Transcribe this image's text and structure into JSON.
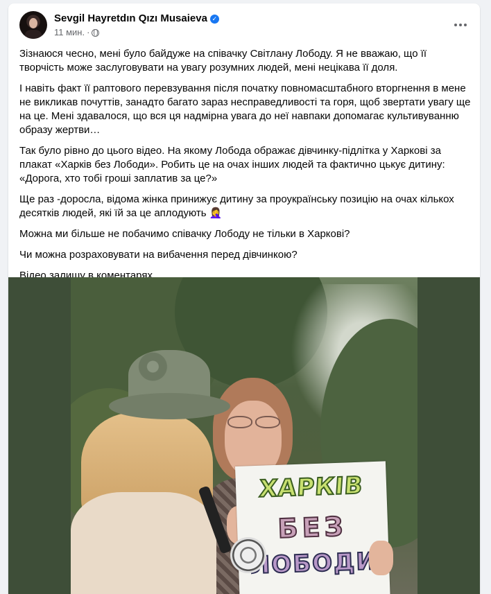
{
  "post": {
    "author": "Sevgil Hayretdın Qızı Musaieva",
    "time": "11 мин.",
    "separator": "·",
    "paragraphs": [
      "Зізнаюся чесно, мені було байдуже на співачку Світлану Лободу.  Я не вважаю, що її творчість може заслуговувати на увагу розумних людей, мені нецікава її доля.",
      "І навіть факт її раптового перевзування після початку повномасштабного вторгнення в мене не викликав почуттів, занадто багато зараз несправедливості та горя, щоб звертати увагу ще на це. Мені здавалося, що вся ця надмірна увага до неї навпаки допомагає культивуванню образу жертви…",
      "Так було рівно до цього відео. На якому Лобода ображає дівчинку-підлітка у Харкові за плакат «Харків без Лободи». Робить це на очах інших людей та фактично цькує дитину: «Дорога, хто тобі гроші заплатив за це?»",
      "Ще раз -доросла, відома жінка принижує дитину за проукраїнську позицію на очах кількох десятків людей, які їй за це аплодують 🤦‍♀️",
      "Можна ми більше не побачимо співачку Лободу не тільки в Харкові?",
      "Чи можна розраховувати на вибачення перед дівчинкою?",
      "Відео залишу в коментарях"
    ]
  },
  "video": {
    "poster_lines": [
      "ХАРКІВ",
      "БЕЗ",
      "ЛОБОДИ"
    ]
  },
  "icons": {
    "verified": "verified-badge-icon",
    "privacy": "globe-icon",
    "more": "more-options-icon"
  },
  "colors": {
    "page_bg": "#f0f2f5",
    "card_bg": "#ffffff",
    "accent": "#1877f2",
    "secondary_text": "#65676b",
    "media_bg": "#3e4e38"
  }
}
